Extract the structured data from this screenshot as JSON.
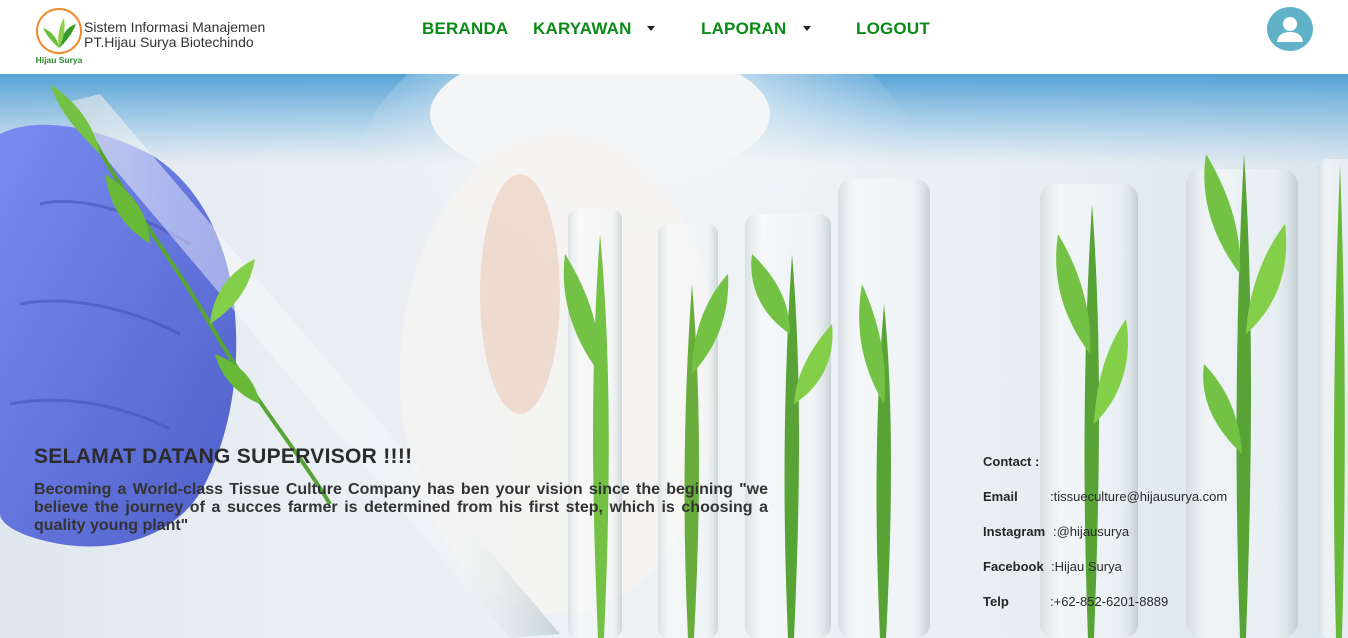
{
  "header": {
    "logo_text": "Hijau Surya",
    "brand_line1": "Sistem Informasi Manajemen",
    "brand_line2": "PT.Hijau Surya Biotechindo",
    "nav": {
      "home": "BERANDA",
      "employees": "KARYAWAN",
      "reports": "LAPORAN",
      "logout": "LOGOUT"
    }
  },
  "hero": {
    "title": "SELAMAT DATANG SUPERVISOR !!!!",
    "text": "Becoming a World-class Tissue Culture Company has ben your vision since the begining \"we believe the journey of a succes farmer is determined from his first step, which is choosing a quality young plant\""
  },
  "contact": {
    "heading": "Contact :",
    "email_label": "Email",
    "email_value": ":tissueculture@hijausurya.com",
    "instagram_label": "Instagram",
    "instagram_value": ":@hijausurya",
    "facebook_label": "Facebook",
    "facebook_value": ":Hijau Surya",
    "phone_label": "Telp",
    "phone_value": ":+62-852-6201-8889"
  },
  "colors": {
    "nav_green": "#0a8a16",
    "avatar_blue": "#5fb2c8",
    "glove_blue": "#5b6fe0",
    "leaf_green": "#5fb52b"
  }
}
